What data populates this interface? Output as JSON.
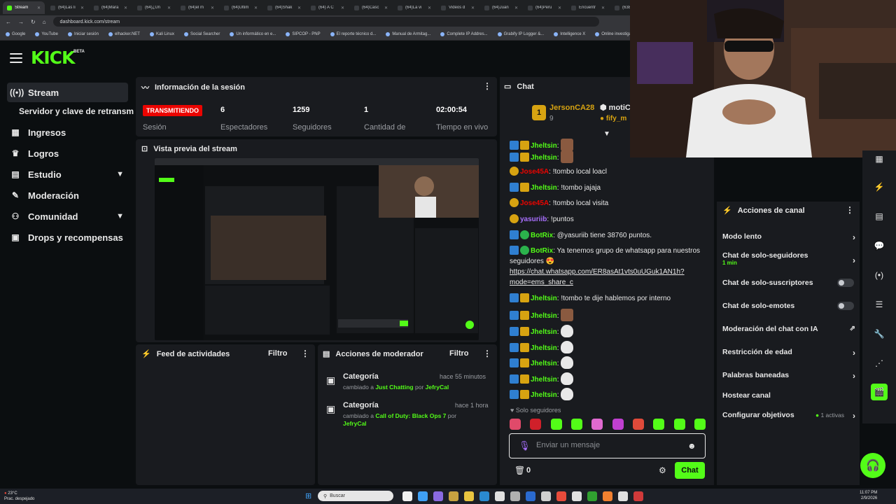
{
  "browser": {
    "tabs": [
      {
        "label": "Stream",
        "active": true
      },
      {
        "label": "(64)Las li"
      },
      {
        "label": "(64)Mara"
      },
      {
        "label": "(64)¿Un"
      },
      {
        "label": "(64)el m"
      },
      {
        "label": "(64)Ultim"
      },
      {
        "label": "(64)Shak"
      },
      {
        "label": "(64) A C"
      },
      {
        "label": "(64)Casc"
      },
      {
        "label": "(64)La vi"
      },
      {
        "label": "Videos d"
      },
      {
        "label": "(64)Juan"
      },
      {
        "label": "(64)Peru"
      },
      {
        "label": "Encuentr"
      },
      {
        "label": "(6385)"
      }
    ],
    "url": "dashboard.kick.com/stream",
    "bookmarks": [
      "Google",
      "YouTube",
      "Iniciar sesión",
      "elhacker.NET",
      "Kali Linux",
      "Social Searcher",
      "Un informático en e...",
      "SIPCOP - PNP",
      "El reporte técnico d...",
      "Manual de Armitag...",
      "Complete IP Addres...",
      "Grabify IP Logger &...",
      "Intelligence X",
      "Online investigation..."
    ]
  },
  "header": {
    "logo": "KICK",
    "beta": "BETA"
  },
  "sidebar": {
    "items": [
      {
        "label": "Stream",
        "icon": "broadcast-icon"
      },
      {
        "label": "Servidor y clave de retransm"
      },
      {
        "label": "Ingresos",
        "icon": "bar-chart-icon"
      },
      {
        "label": "Logros",
        "icon": "trophy-icon"
      },
      {
        "label": "Estudio",
        "icon": "studio-icon"
      },
      {
        "label": "Moderación",
        "icon": "wrench-icon"
      },
      {
        "label": "Comunidad",
        "icon": "community-icon"
      },
      {
        "label": "Drops y recompensas",
        "icon": "drops-icon"
      }
    ]
  },
  "session": {
    "title": "Información de la sesión",
    "live": "TRANSMITIENDO",
    "live_label": "Sesión",
    "stats": [
      {
        "value": "6",
        "label": "Espectadores"
      },
      {
        "value": "1259",
        "label": "Seguidores"
      },
      {
        "value": "1",
        "label": "Cantidad de"
      },
      {
        "value": "02:00:54",
        "label": "Tiempo en vivo"
      }
    ]
  },
  "preview": {
    "title": "Vista previa del stream"
  },
  "activity": {
    "title": "Feed de actividades",
    "filter": "Filtro"
  },
  "modactions": {
    "title": "Acciones de moderador",
    "filter": "Filtro",
    "items": [
      {
        "title": "Categoría",
        "time": "hace 55 minutos",
        "prefix": "cambiado a ",
        "category": "Just Chatting",
        "by": " por ",
        "user": "JefryCal"
      },
      {
        "title": "Categoría",
        "time": "hace 1 hora",
        "prefix": "cambiado a ",
        "category": "Call of Duty: Black Ops 7",
        "by": " por ",
        "user": "JefryCal"
      }
    ]
  },
  "chat": {
    "title": "Chat",
    "pinned": {
      "user": "JersonCA28",
      "count": "9",
      "second_user": "motiC",
      "third_user": "fify_m"
    },
    "messages": [
      {
        "user": "Jheltsin",
        "cls": "u-jhel",
        "text": "",
        "emote": "face"
      },
      {
        "user": "Jheltsin",
        "cls": "u-jhel",
        "text": "",
        "emote": "face"
      },
      {
        "user": "Jose45A",
        "cls": "u-jose",
        "text": "!tombo local loacl"
      },
      {
        "user": "Jheltsin",
        "cls": "u-jhel",
        "text": "!tombo jajaja"
      },
      {
        "user": "Jose45A",
        "cls": "u-jose",
        "text": "!tombo local visita"
      },
      {
        "user": "yasuriib",
        "cls": "u-yas",
        "text": "!puntos"
      },
      {
        "user": "BotRix",
        "cls": "u-bot",
        "text": "@yasuriib tiene 38760 puntos."
      },
      {
        "user": "BotRix",
        "cls": "u-bot",
        "text": "Ya tenemos grupo de whatsapp para nuestros seguidores 😍",
        "link": "https://chat.whatsapp.com/ER8asAt1vts0uUGuk1AN1h?mode=ems_share_c"
      },
      {
        "user": "Jheltsin",
        "cls": "u-jhel",
        "text": "!tombo te dije hablemos por interno"
      },
      {
        "user": "Jheltsin",
        "cls": "u-jhel",
        "text": "",
        "emote": "face"
      },
      {
        "user": "Jheltsin",
        "cls": "u-jhel",
        "text": "",
        "emote": "white"
      },
      {
        "user": "Jheltsin",
        "cls": "u-jhel",
        "text": "",
        "emote": "white"
      },
      {
        "user": "Jheltsin",
        "cls": "u-jhel",
        "text": "",
        "emote": "white"
      },
      {
        "user": "Jheltsin",
        "cls": "u-jhel",
        "text": "",
        "emote": "white"
      },
      {
        "user": "Jheltsin",
        "cls": "u-jhel",
        "text": "",
        "emote": "white"
      }
    ],
    "followers_only": "Solo seguidores",
    "input_placeholder": "Enviar un mensaje",
    "points": "0",
    "send": "Chat"
  },
  "channel_actions": {
    "title": "Acciones de canal",
    "rows": [
      {
        "label": "Modo lento",
        "control": "arrow"
      },
      {
        "label": "Chat de solo-seguidores",
        "sub": "1 min",
        "control": "arrow"
      },
      {
        "label": "Chat de solo-suscriptores",
        "control": "toggle"
      },
      {
        "label": "Chat de solo-emotes",
        "control": "toggle"
      },
      {
        "label": "Moderación del chat con IA",
        "control": "external"
      },
      {
        "label": "Restricción de edad",
        "control": "arrow"
      },
      {
        "label": "Palabras baneadas",
        "control": "arrow"
      },
      {
        "label": "Hostear canal",
        "control": "none"
      },
      {
        "label": "Configurar objetivos",
        "extra": "1 activas",
        "control": "arrow"
      }
    ]
  },
  "taskbar": {
    "weather_temp": "23°C",
    "weather_desc": "Prac. despejado",
    "search": "Buscar",
    "time": "11:07 PM",
    "date": "2/9/2026"
  },
  "colors": {
    "accent": "#53fc18",
    "live": "#eb0400",
    "panel": "#191b1f",
    "bg": "#0b0e10"
  }
}
